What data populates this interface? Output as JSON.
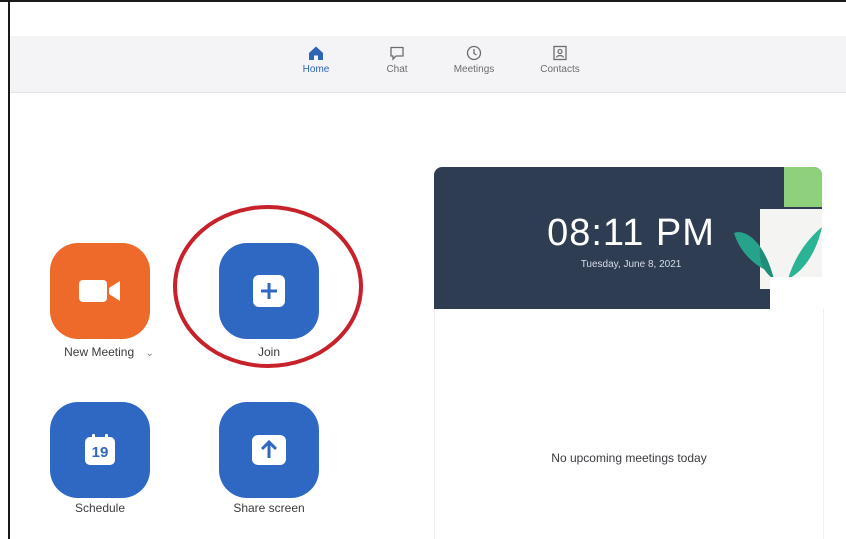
{
  "nav": {
    "home_label": "Home",
    "chat_label": "Chat",
    "meetings_label": "Meetings",
    "contacts_label": "Contacts",
    "active": "Home"
  },
  "actions": {
    "new_meeting_label": "New Meeting",
    "new_meeting_caret": "⌄",
    "join_label": "Join",
    "schedule_label": "Schedule",
    "schedule_day": "19",
    "share_screen_label": "Share screen"
  },
  "clock": {
    "time": "08:11 PM",
    "date": "Tuesday, June 8, 2021"
  },
  "upcoming": {
    "empty_message": "No upcoming meetings today"
  },
  "colors": {
    "accent_blue": "#2f68c2",
    "accent_orange": "#ee6a2b",
    "highlight_red": "#c7212b",
    "clock_bg": "#2e3d52"
  }
}
